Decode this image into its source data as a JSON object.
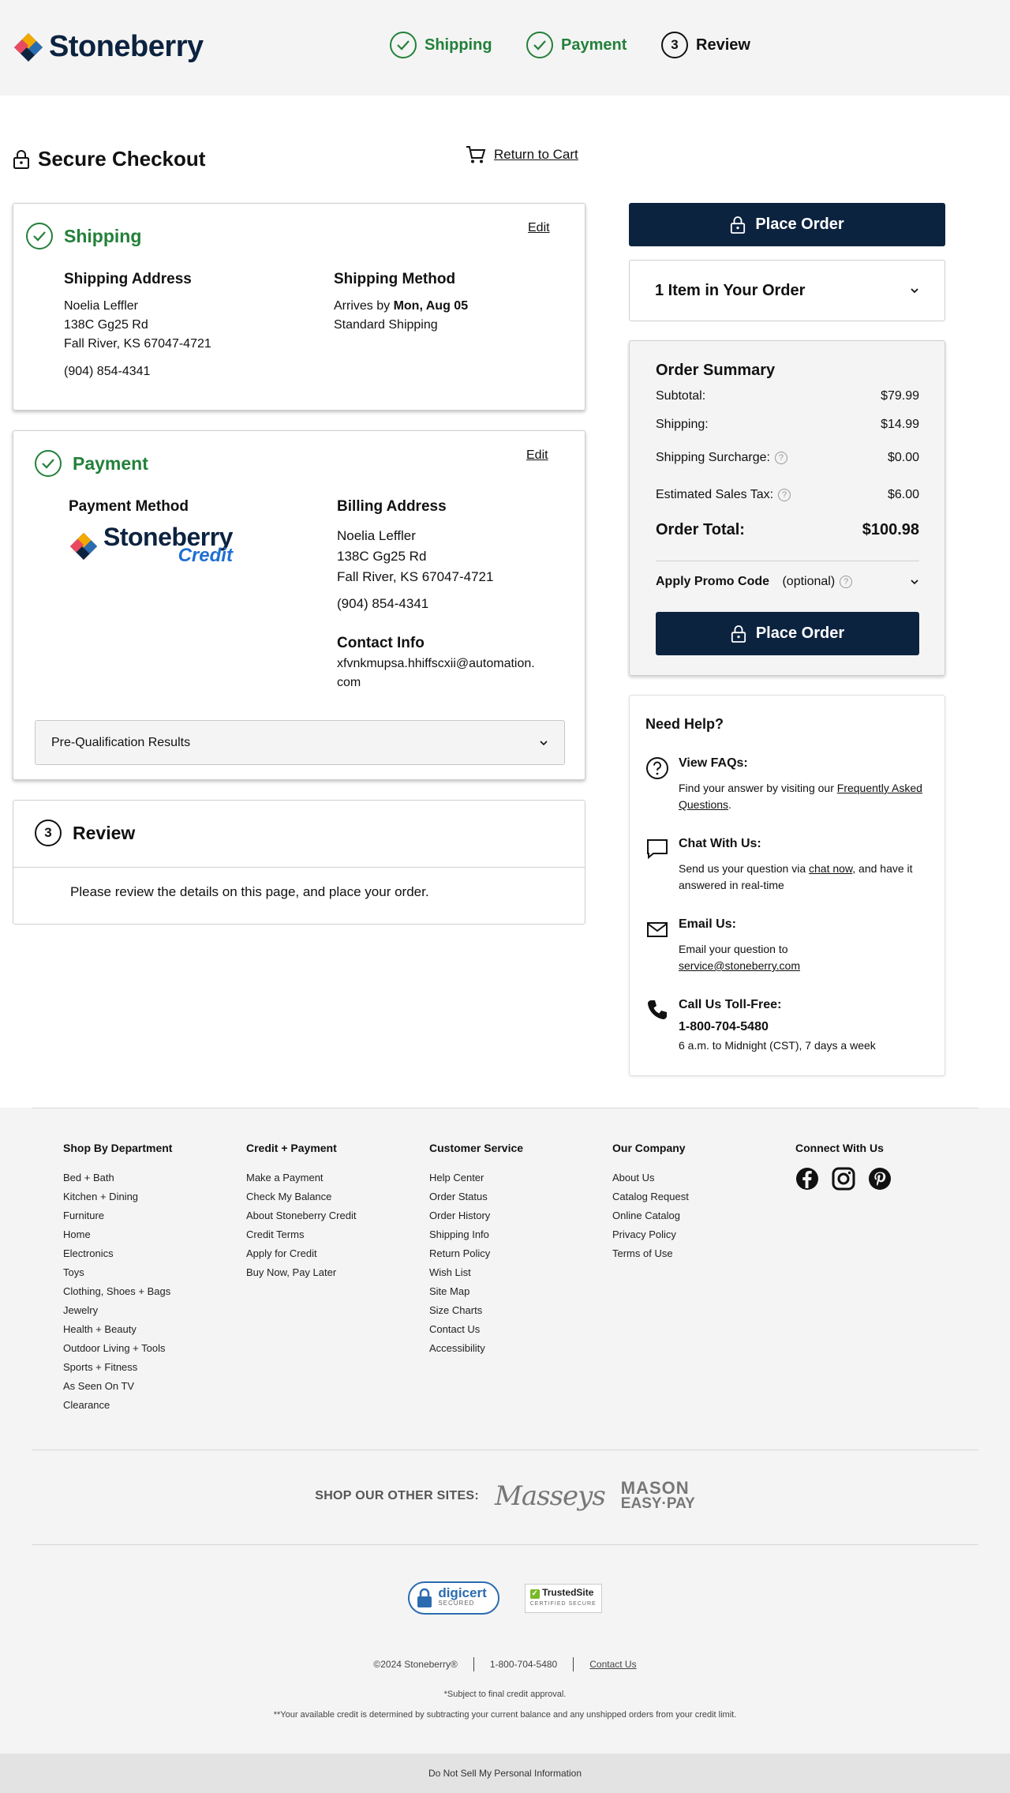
{
  "header": {
    "brand": "Stoneberry",
    "steps": [
      {
        "label": "Shipping",
        "state": "done"
      },
      {
        "label": "Payment",
        "state": "done"
      },
      {
        "label": "Review",
        "number": "3",
        "state": "current"
      }
    ]
  },
  "page": {
    "title": "Secure Checkout",
    "return_to_cart": "Return to Cart"
  },
  "shipping": {
    "title": "Shipping",
    "edit": "Edit",
    "address_heading": "Shipping Address",
    "name": "Noelia Leffler",
    "street": "138C Gg25 Rd",
    "city": "Fall River, KS 67047-4721",
    "phone": "(904) 854-4341",
    "method_heading": "Shipping Method",
    "arrives_prefix": "Arrives by",
    "arrives_date": "Mon, Aug 05",
    "method": "Standard Shipping"
  },
  "payment": {
    "title": "Payment",
    "edit": "Edit",
    "method_heading": "Payment Method",
    "credit_logo_brand": "Stoneberry",
    "credit_logo_sub": "Credit",
    "billing_heading": "Billing Address",
    "name": "Noelia Leffler",
    "street": "138C Gg25 Rd",
    "city": "Fall River, KS 67047-4721",
    "phone": "(904) 854-4341",
    "contact_heading": "Contact Info",
    "email_line1": "xfvnkmupsa.hhiffscxii@automation.",
    "email_line2": "com",
    "prequal": "Pre-Qualification Results"
  },
  "review": {
    "number": "3",
    "title": "Review",
    "body": "Please review the details on this page, and place your order."
  },
  "order": {
    "place_order": "Place Order",
    "items_label": "1 Item in Your Order",
    "summary_title": "Order Summary",
    "rows": [
      {
        "label": "Subtotal:",
        "value": "$79.99"
      },
      {
        "label": "Shipping:",
        "value": "$14.99"
      },
      {
        "label": "Shipping Surcharge:",
        "value": "$0.00"
      },
      {
        "label": "Estimated Sales Tax:",
        "value": "$6.00"
      }
    ],
    "total_label": "Order Total:",
    "total_value": "$100.98",
    "promo_label": "Apply Promo Code",
    "promo_optional": "(optional)"
  },
  "help": {
    "title": "Need Help?",
    "faq_heading": "View FAQs:",
    "faq_text": "Find your answer by visiting our",
    "faq_link": "Frequently Asked Questions",
    "chat_heading": "Chat With Us:",
    "chat_text1": "Send us your question via",
    "chat_link": "chat now",
    "chat_text2": ", and have it answered in real-time",
    "email_heading": "Email Us:",
    "email_text": "Email your question to",
    "email_link": "service@stoneberry.com",
    "call_heading": "Call Us Toll-Free:",
    "call_number": "1-800-704-5480",
    "call_hours": "6 a.m. to Midnight (CST), 7 days a week"
  },
  "footer": {
    "columns": [
      {
        "heading": "Shop By Department",
        "links": [
          "Bed + Bath",
          "Kitchen + Dining",
          "Furniture",
          "Home",
          "Electronics",
          "Toys",
          "Clothing, Shoes + Bags",
          "Jewelry",
          "Health + Beauty",
          "Outdoor Living + Tools",
          "Sports + Fitness",
          "As Seen On TV",
          "Clearance"
        ]
      },
      {
        "heading": "Credit + Payment",
        "links": [
          "Make a Payment",
          "Check My Balance",
          "About Stoneberry Credit",
          "Credit Terms",
          "Apply for Credit",
          "Buy Now, Pay Later"
        ]
      },
      {
        "heading": "Customer Service",
        "links": [
          "Help Center",
          "Order Status",
          "Order History",
          "Shipping Info",
          "Return Policy",
          "Wish List",
          "Site Map",
          "Size Charts",
          "Contact Us",
          "Accessibility"
        ]
      },
      {
        "heading": "Our Company",
        "links": [
          "About Us",
          "Catalog Request",
          "Online Catalog",
          "Privacy Policy",
          "Terms of Use"
        ]
      }
    ],
    "connect_heading": "Connect With Us",
    "other_sites_label": "SHOP OUR OTHER SITES:",
    "masseys": "Masseys",
    "mason_line1": "MASON",
    "mason_line2": "EASY·PAY",
    "digicert": "digicert",
    "digicert_sub": "SECURED",
    "trustedsite": "TrustedSite",
    "trustedsite_sub": "CERTIFIED SECURE",
    "copyright": "©2024 Stoneberry®",
    "phone": "1-800-704-5480",
    "contact": "Contact Us",
    "fine1": "*Subject to final credit approval.",
    "fine2": "**Your available credit is determined by subtracting your current balance and any unshipped orders from your credit limit.",
    "do_not_sell": "Do Not Sell My Personal Information"
  }
}
